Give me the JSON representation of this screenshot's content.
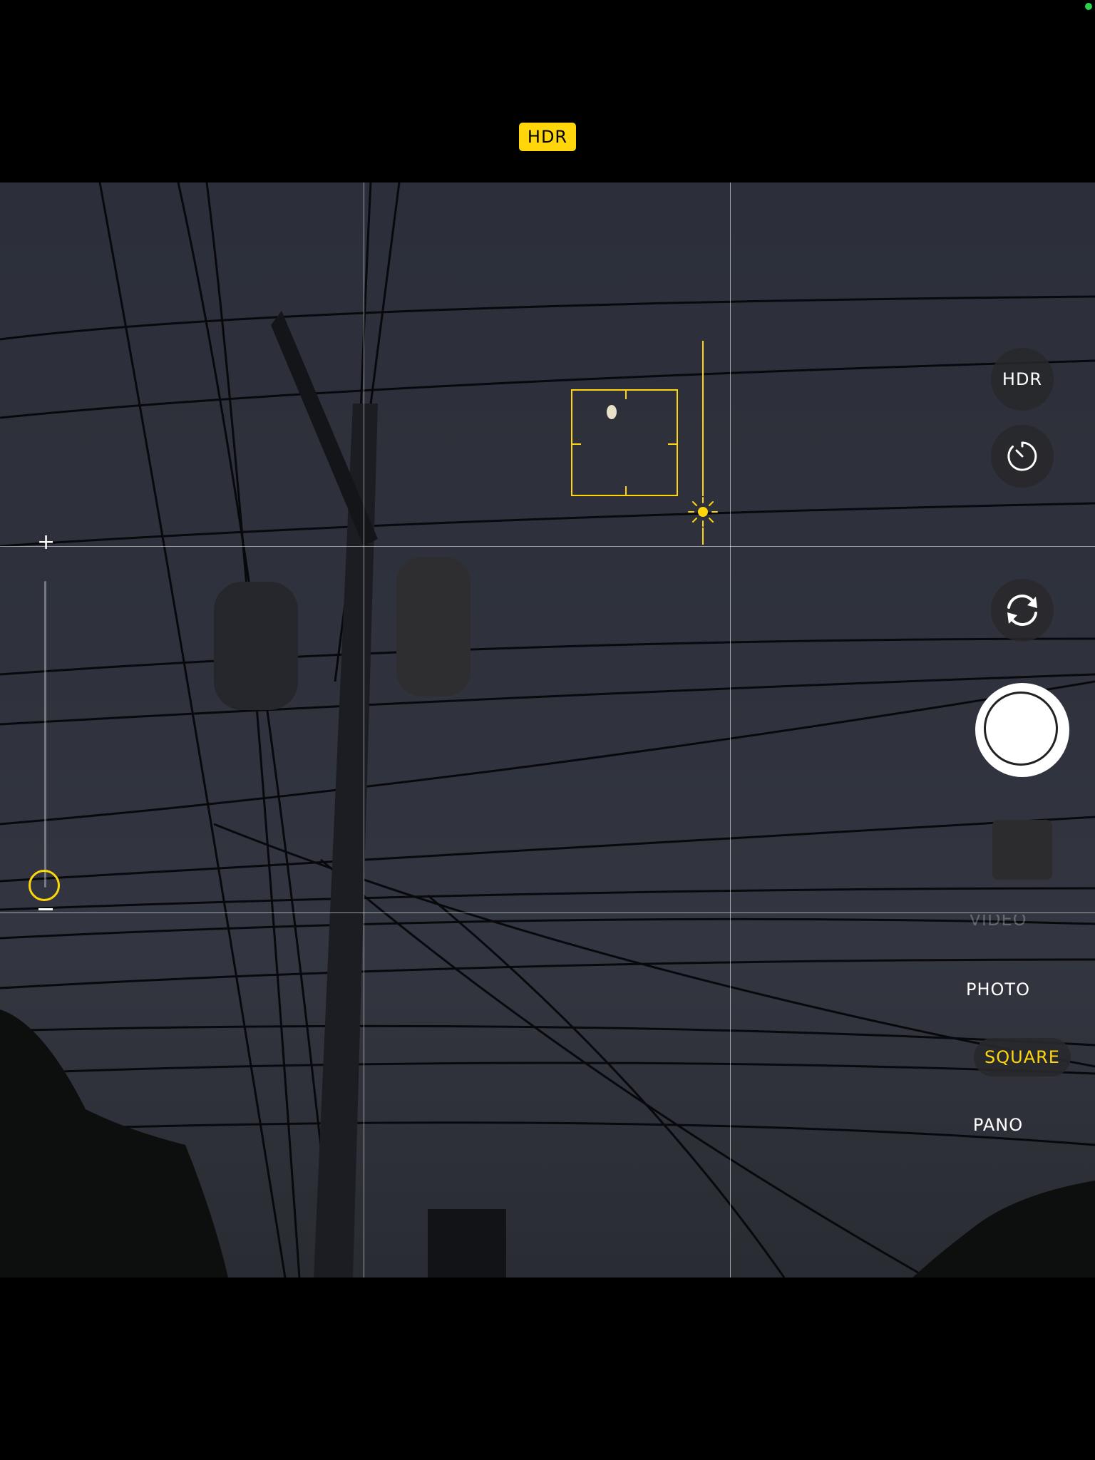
{
  "top_bar": {
    "hdr_badge": "HDR"
  },
  "controls": {
    "hdr_button": "HDR",
    "timer_icon": "timer-icon",
    "flip_icon": "camera-flip-icon",
    "exposure_icon": "sun-icon"
  },
  "zoom": {
    "plus": "+",
    "minus": "−",
    "level": 0.05
  },
  "modes": {
    "items": [
      {
        "label": "VIDEO",
        "state": "partially-hidden"
      },
      {
        "label": "PHOTO",
        "state": "normal"
      },
      {
        "label": "SQUARE",
        "state": "selected"
      },
      {
        "label": "PANO",
        "state": "normal"
      }
    ]
  },
  "colors": {
    "accent": "#ffd60a",
    "background": "#000000",
    "status_dot": "#2fcf4f"
  }
}
